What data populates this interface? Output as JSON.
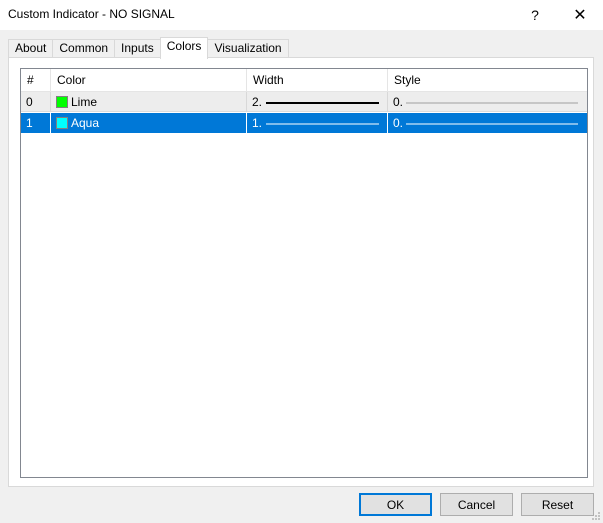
{
  "window": {
    "title": "Custom Indicator - NO SIGNAL",
    "help_glyph": "?",
    "close_glyph": "✕"
  },
  "tabs": [
    {
      "label": "About",
      "active": false
    },
    {
      "label": "Common",
      "active": false
    },
    {
      "label": "Inputs",
      "active": false
    },
    {
      "label": "Colors",
      "active": true
    },
    {
      "label": "Visualization",
      "active": false
    }
  ],
  "grid": {
    "headers": {
      "index": "#",
      "color": "Color",
      "width": "Width",
      "style": "Style"
    },
    "rows": [
      {
        "index": "0",
        "color_name": "Lime",
        "swatch": "#00ff00",
        "width_label": "2.",
        "style_label": "0.",
        "selected": false
      },
      {
        "index": "1",
        "color_name": "Aqua",
        "swatch": "#00ffff",
        "width_label": "1.",
        "style_label": "0.",
        "selected": true
      }
    ]
  },
  "buttons": {
    "ok": "OK",
    "cancel": "Cancel",
    "reset": "Reset"
  },
  "colors": {
    "selection": "#0078d7",
    "accent_border": "#0078d7"
  }
}
